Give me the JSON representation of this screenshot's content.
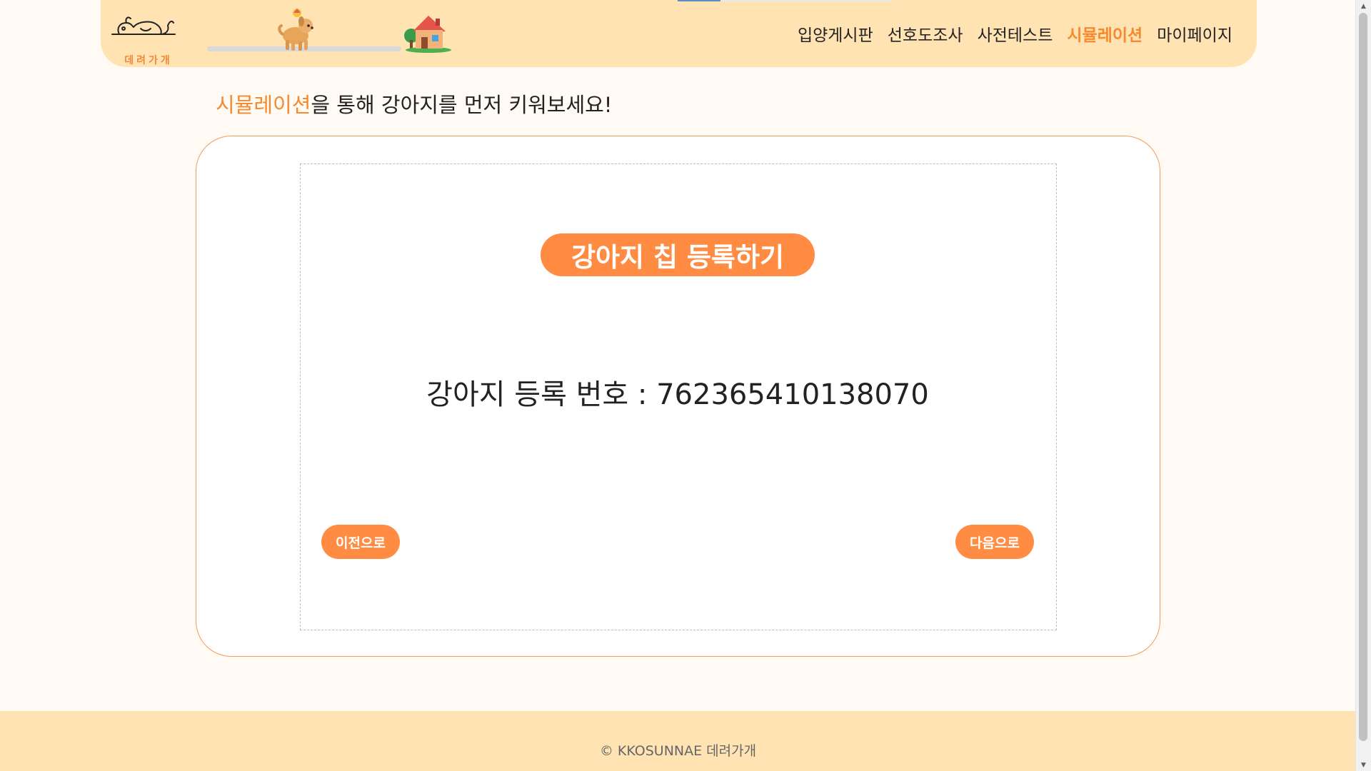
{
  "header": {
    "logo_text": "데려가개",
    "nav": [
      {
        "label": "입양게시판"
      },
      {
        "label": "선호도조사"
      },
      {
        "label": "사전테스트"
      },
      {
        "label": "시뮬레이션"
      },
      {
        "label": "마이페이지"
      }
    ],
    "active_nav": "시뮬레이션",
    "progress": 0.45
  },
  "headline": {
    "accent": "시뮬레이션",
    "rest": "을 통해 강아지를 먼저 키워보세요!"
  },
  "step": {
    "title": "강아지 칩 등록하기",
    "registration_label": "강아지 등록 번호 : ",
    "registration_number": "762365410138070",
    "prev_label": "이전으로",
    "next_label": "다음으로"
  },
  "footer": {
    "copyright": "© KKOSUNNAE 데려가개"
  },
  "colors": {
    "accent": "#ff8c42",
    "header_bg": "#ffe3b3",
    "page_bg": "#fffaf4"
  },
  "icons": {
    "logo": "sleeping-dog-icon",
    "progress_marker": "dog-icon",
    "goal": "house-icon"
  }
}
